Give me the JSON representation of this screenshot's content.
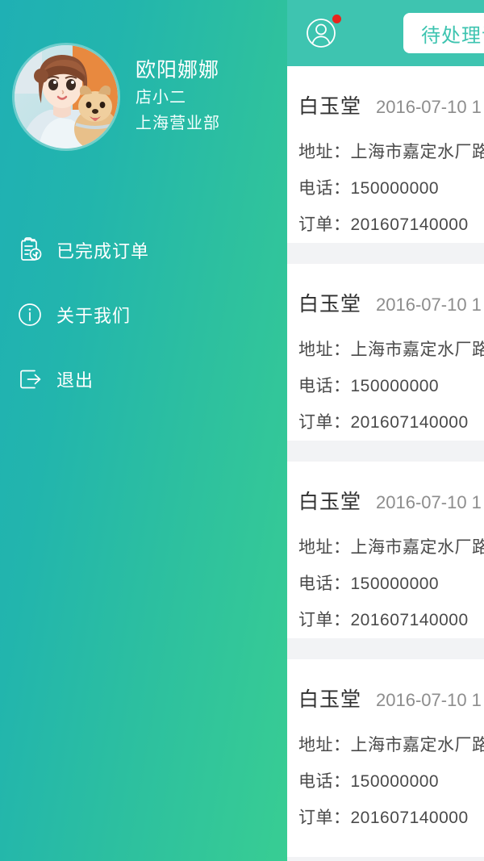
{
  "sidebar": {
    "profile": {
      "avatar_icon": "user-photo-girl-with-dog",
      "name": "欧阳娜娜",
      "role": "店小二",
      "branch": "上海营业部"
    },
    "menu": [
      {
        "icon": "clipboard-check-icon",
        "label": "已完成订单"
      },
      {
        "icon": "info-circle-icon",
        "label": "关于我们"
      },
      {
        "icon": "logout-arrow-icon",
        "label": "退出"
      }
    ]
  },
  "topbar": {
    "user_icon": "user-avatar-icon",
    "badge_icon": "notification-dot",
    "pending_button_label": "待处理订单"
  },
  "orders": [
    {
      "shop": "白玉堂",
      "time": "2016-07-10 1",
      "address_label": "地址：",
      "address": "上海市嘉定水厂路",
      "phone_label": "电话：",
      "phone": "150000000",
      "order_label": "订单：",
      "order_no": "201607140000"
    },
    {
      "shop": "白玉堂",
      "time": "2016-07-10 1",
      "address_label": "地址：",
      "address": "上海市嘉定水厂路",
      "phone_label": "电话：",
      "phone": "150000000",
      "order_label": "订单：",
      "order_no": "201607140000"
    },
    {
      "shop": "白玉堂",
      "time": "2016-07-10 1",
      "address_label": "地址：",
      "address": "上海市嘉定水厂路",
      "phone_label": "电话：",
      "phone": "150000000",
      "order_label": "订单：",
      "order_no": "201607140000"
    },
    {
      "shop": "白玉堂",
      "time": "2016-07-10 1",
      "address_label": "地址：",
      "address": "上海市嘉定水厂路",
      "phone_label": "电话：",
      "phone": "150000000",
      "order_label": "订单：",
      "order_no": "201607140000"
    }
  ],
  "colors": {
    "sidebar_gradient_start": "#1fb0b4",
    "sidebar_gradient_end": "#38cd93",
    "topbar": "#3ec4b0",
    "accent_teal": "#3ec4b0",
    "badge_red": "#e8251d",
    "card_bg": "#ffffff",
    "page_bg": "#f2f3f5",
    "shop_text": "#2f2f2f",
    "meta_text": "#8d8d8d"
  }
}
